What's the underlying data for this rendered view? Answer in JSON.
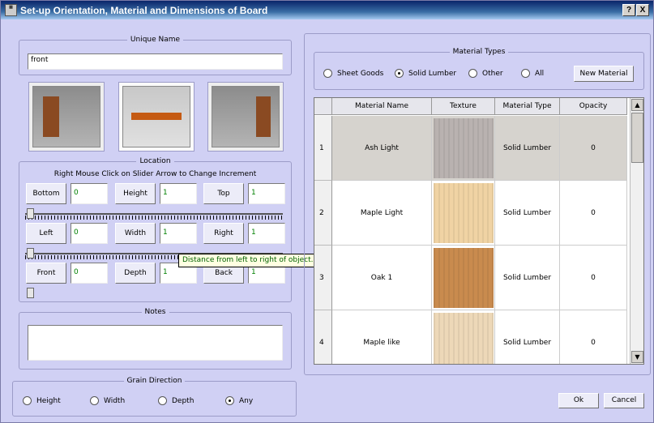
{
  "window": {
    "title": "Set-up Orientation, Material and Dimensions of Board",
    "app_icon": "app-icon",
    "help_label": "?",
    "close_label": "X"
  },
  "unique_name": {
    "legend": "Unique Name",
    "value": "front"
  },
  "previews": [
    {
      "name": "left-side-preview"
    },
    {
      "name": "shelf-preview"
    },
    {
      "name": "right-side-preview"
    }
  ],
  "location": {
    "legend": "Location",
    "hint": "Right Mouse Click on Slider Arrow to Change Increment",
    "rows": [
      [
        {
          "label": "Bottom",
          "value": "0"
        },
        {
          "label": "Height",
          "value": "1"
        },
        {
          "label": "Top",
          "value": "1"
        }
      ],
      [
        {
          "label": "Left",
          "value": "0"
        },
        {
          "label": "Width",
          "value": "1"
        },
        {
          "label": "Right",
          "value": "1"
        }
      ],
      [
        {
          "label": "Front",
          "value": "0"
        },
        {
          "label": "Depth",
          "value": "1"
        },
        {
          "label": "Back",
          "value": "1"
        }
      ]
    ]
  },
  "tooltip": "Distance from left to right of object.",
  "notes": {
    "legend": "Notes",
    "value": ""
  },
  "grain": {
    "legend": "Grain Direction",
    "options": [
      "Height",
      "Width",
      "Depth",
      "Any"
    ],
    "selected": "Any"
  },
  "material_types": {
    "legend": "Material Types",
    "options": [
      "Sheet Goods",
      "Solid Lumber",
      "Other",
      "All"
    ],
    "selected": "Solid Lumber",
    "new_button": "New Material"
  },
  "table": {
    "columns": [
      "Material Name",
      "Texture",
      "Material Type",
      "Opacity"
    ],
    "rows": [
      {
        "num": "1",
        "name": "Ash Light",
        "texture_color": "#b9b2b0",
        "type": "Solid Lumber",
        "opacity": "0",
        "selected": true
      },
      {
        "num": "2",
        "name": "Maple Light",
        "texture_color": "#f0d3a4",
        "type": "Solid Lumber",
        "opacity": "0"
      },
      {
        "num": "3",
        "name": "Oak 1",
        "texture_color": "#c98b4e",
        "type": "Solid Lumber",
        "opacity": "0"
      },
      {
        "num": "4",
        "name": "Maple like",
        "texture_color": "#edd8b8",
        "type": "Solid Lumber",
        "opacity": "0"
      }
    ]
  },
  "buttons": {
    "ok": "Ok",
    "cancel": "Cancel"
  },
  "colors": {
    "window_bg": "#d0d0f4",
    "tooltip_bg": "#ffffe1",
    "selected_row": "#d6d3ce"
  }
}
